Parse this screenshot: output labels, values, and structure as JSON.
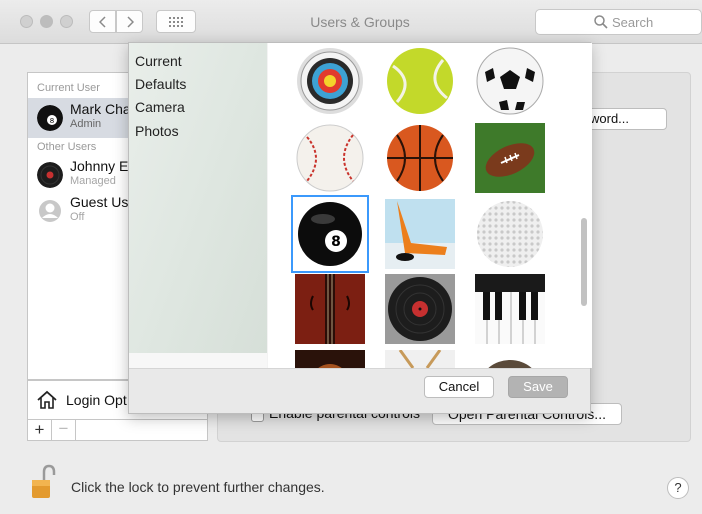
{
  "window": {
    "title": "Users & Groups",
    "search_placeholder": "Search"
  },
  "users": {
    "current_label": "Current User",
    "current": {
      "name": "Mark Cha",
      "role": "Admin"
    },
    "other_label": "Other Users",
    "others": [
      {
        "name": "Johnny E",
        "role": "Managed"
      },
      {
        "name": "Guest Us",
        "role": "Off"
      }
    ],
    "login_options_label": "Login Opt",
    "add_label": "+",
    "remove_label": "−"
  },
  "main": {
    "password_button": "ssword...",
    "parental_checkbox_label": "Enable parental controls",
    "parental_button": "Open Parental Controls..."
  },
  "picker": {
    "sources": [
      "Current",
      "Defaults",
      "Camera",
      "Photos"
    ],
    "selected_source": "Defaults",
    "images": [
      "target-icon",
      "tennis-ball-icon",
      "soccer-ball-icon",
      "baseball-icon",
      "basketball-icon",
      "football-icon",
      "eight-ball-icon",
      "hockey-icon",
      "golf-ball-icon",
      "violin-icon",
      "record-icon",
      "piano-icon",
      "guitar-icon",
      "drum-icon",
      "nautilus-icon"
    ],
    "selected_image": "eight-ball-icon",
    "cancel_label": "Cancel",
    "save_label": "Save"
  },
  "footer": {
    "lock_text": "Click the lock to prevent further changes.",
    "help_label": "?"
  },
  "colors": {
    "selection_outline": "#3b99fc",
    "save_disabled": "#b3b3b3"
  }
}
